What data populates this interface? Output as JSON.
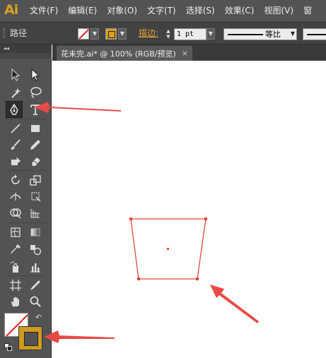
{
  "app": {
    "logo": "Ai"
  },
  "menu": {
    "items": [
      "文件(F)",
      "编辑(E)",
      "对象(O)",
      "文字(T)",
      "选择(S)",
      "效果(C)",
      "视图(V)",
      "窗"
    ]
  },
  "control_bar": {
    "selection_label": "路径",
    "stroke_label": "描边:",
    "stroke_weight": "1 pt",
    "profile_label": "等比"
  },
  "document": {
    "tab_label": "花未完.ai* @ 100% (RGB/预览)",
    "close_label": "×"
  },
  "tools": {
    "active": "pen-tool",
    "fill": "none",
    "stroke_color": "#cf9a1e"
  },
  "colors": {
    "accent": "#e8a23a",
    "path_color": "#e8453c",
    "arrow_color": "#e84a46"
  }
}
